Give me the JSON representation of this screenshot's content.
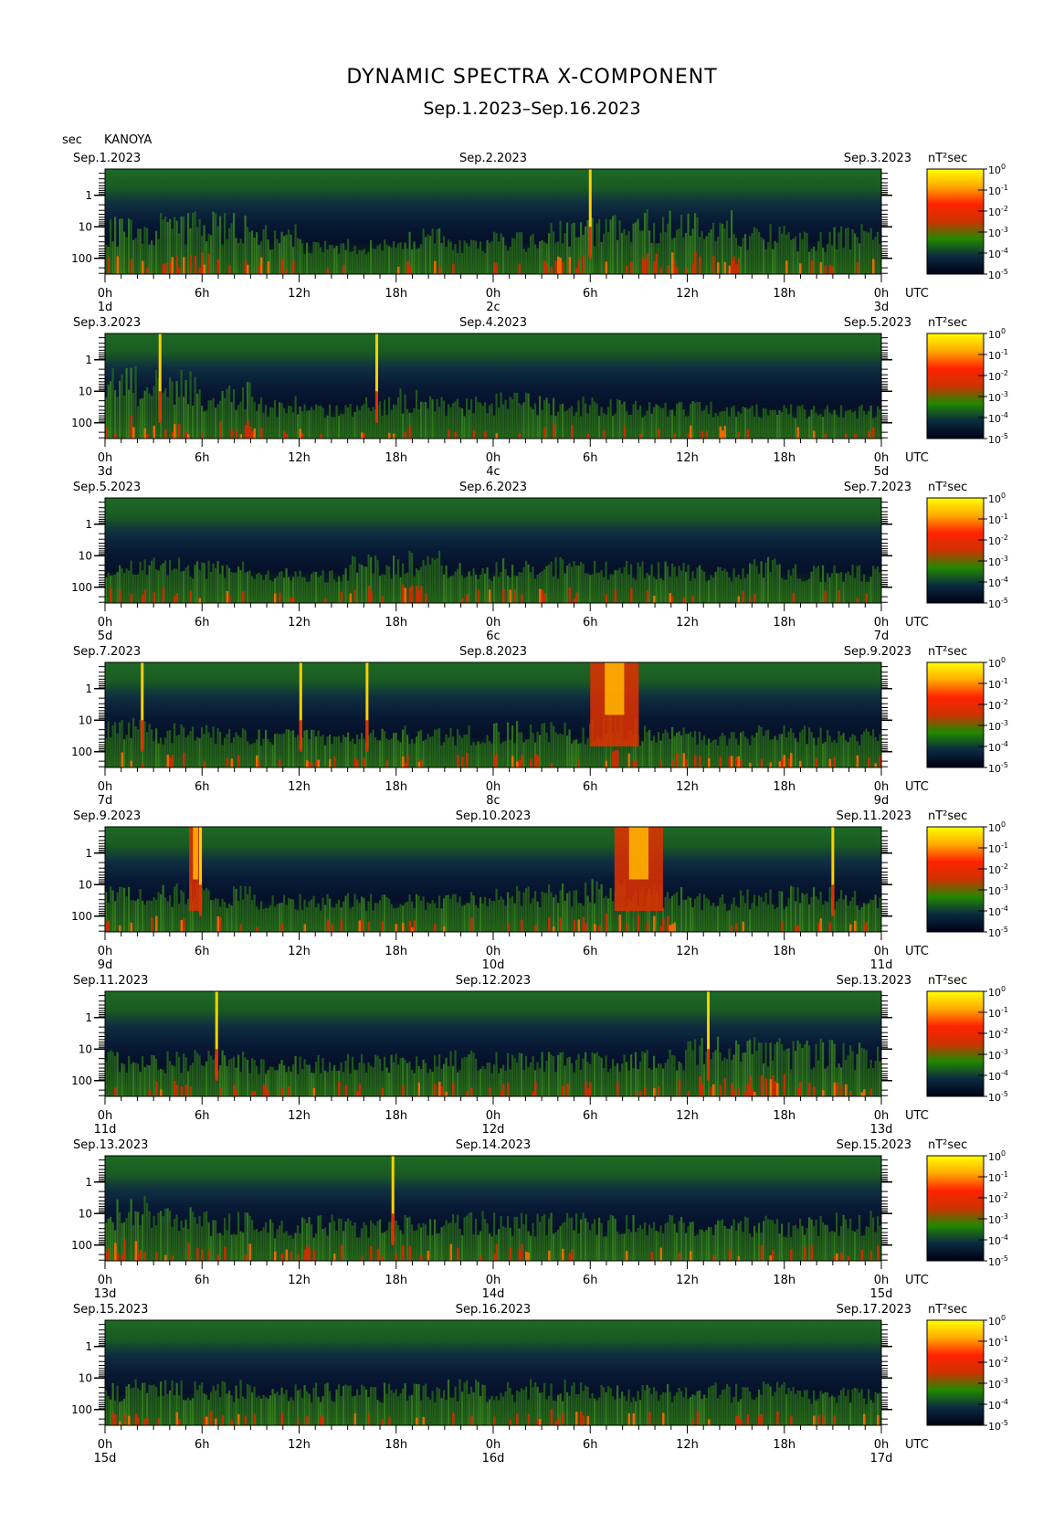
{
  "header": {
    "title": "DYNAMIC SPECTRA X-COMPONENT",
    "subtitle": "Sep.1.2023–Sep.16.2023",
    "unit_left": "sec",
    "station": "KANOYA"
  },
  "chart_data": {
    "type": "heatmap",
    "y_axis": {
      "ticks": [
        "1",
        "10",
        "100"
      ],
      "scale": "log",
      "unit": "sec"
    },
    "x_axis": {
      "hour_ticks": [
        "0h",
        "6h",
        "12h",
        "18h",
        "0h",
        "6h",
        "12h",
        "18h",
        "0h"
      ],
      "utc_label": "UTC"
    },
    "colorbar": {
      "unit_label": "nT²sec",
      "tick_exponents": [
        "0",
        "-1",
        "-2",
        "-3",
        "-4",
        "-5"
      ],
      "colors": [
        "#ffff00",
        "#ffaa00",
        "#ff2200",
        "#cc3300",
        "#228800",
        "#0a2a40",
        "#000015"
      ]
    },
    "panels": [
      {
        "date_left": "Sep.1.2023",
        "date_mid": "Sep.2.2023",
        "date_right": "Sep.3.2023",
        "day_left": "1d",
        "day_mid": "2c",
        "day_right": "3d",
        "spikes": [
          30
        ],
        "strong_events": [],
        "activity_profile": [
          0.6,
          0.7,
          0.7,
          0.5,
          0.3,
          0.3,
          0.45,
          0.3,
          0.4,
          0.6,
          0.65,
          0.7,
          0.7,
          0.5,
          0.4,
          0.5
        ]
      },
      {
        "date_left": "Sep.3.2023",
        "date_mid": "Sep.4.2023",
        "date_right": "Sep.5.2023",
        "day_left": "3d",
        "day_mid": "4c",
        "day_right": "5d",
        "spikes": [
          3.4,
          16.8
        ],
        "strong_events": [],
        "activity_profile": [
          0.8,
          0.8,
          0.6,
          0.4,
          0.3,
          0.4,
          0.5,
          0.4,
          0.45,
          0.4,
          0.4,
          0.35,
          0.35,
          0.3,
          0.3,
          0.3
        ]
      },
      {
        "date_left": "Sep.5.2023",
        "date_mid": "Sep.6.2023",
        "date_right": "Sep.7.2023",
        "day_left": "5d",
        "day_mid": "6c",
        "day_right": "7d",
        "spikes": [],
        "strong_events": [],
        "activity_profile": [
          0.45,
          0.45,
          0.4,
          0.3,
          0.3,
          0.5,
          0.55,
          0.4,
          0.45,
          0.45,
          0.4,
          0.4,
          0.35,
          0.45,
          0.35,
          0.35
        ]
      },
      {
        "date_left": "Sep.7.2023",
        "date_mid": "Sep.8.2023",
        "date_right": "Sep.9.2023",
        "day_left": "7d",
        "day_mid": "8c",
        "day_right": "9d",
        "spikes": [
          2.3,
          12.1,
          16.2
        ],
        "strong_events": [
          [
            30.0,
            33.0
          ]
        ],
        "activity_profile": [
          0.5,
          0.45,
          0.4,
          0.35,
          0.35,
          0.35,
          0.4,
          0.4,
          0.45,
          0.45,
          0.55,
          0.4,
          0.35,
          0.4,
          0.4,
          0.35
        ]
      },
      {
        "date_left": "Sep.9.2023",
        "date_mid": "Sep.10.2023",
        "date_right": "Sep.11.2023",
        "day_left": "9d",
        "day_mid": "10d",
        "day_right": "11d",
        "spikes": [
          5.9,
          45.0
        ],
        "strong_events": [
          [
            31.5,
            34.5
          ],
          [
            5.2,
            6.0
          ]
        ],
        "activity_profile": [
          0.45,
          0.5,
          0.45,
          0.35,
          0.35,
          0.35,
          0.35,
          0.4,
          0.45,
          0.5,
          0.55,
          0.45,
          0.35,
          0.4,
          0.45,
          0.4
        ]
      },
      {
        "date_left": "Sep.11.2023",
        "date_mid": "Sep.12.2023",
        "date_right": "Sep.13.2023",
        "day_left": "11d",
        "day_mid": "12d",
        "day_right": "13d",
        "spikes": [
          6.9,
          37.3
        ],
        "strong_events": [],
        "activity_profile": [
          0.45,
          0.45,
          0.45,
          0.4,
          0.4,
          0.4,
          0.4,
          0.45,
          0.45,
          0.45,
          0.45,
          0.5,
          0.65,
          0.7,
          0.6,
          0.55
        ]
      },
      {
        "date_left": "Sep.13.2023",
        "date_mid": "Sep.14.2023",
        "date_right": "Sep.15.2023",
        "day_left": "13d",
        "day_mid": "14d",
        "day_right": "15d",
        "spikes": [
          17.8
        ],
        "strong_events": [],
        "activity_profile": [
          0.7,
          0.55,
          0.5,
          0.4,
          0.45,
          0.4,
          0.45,
          0.5,
          0.5,
          0.5,
          0.45,
          0.45,
          0.4,
          0.45,
          0.45,
          0.5
        ]
      },
      {
        "date_left": "Sep.15.2023",
        "date_mid": "Sep.16.2023",
        "date_right": "Sep.17.2023",
        "day_left": "15d",
        "day_mid": "16d",
        "day_right": "17d",
        "spikes": [],
        "strong_events": [],
        "activity_profile": [
          0.45,
          0.5,
          0.45,
          0.4,
          0.4,
          0.4,
          0.4,
          0.45,
          0.45,
          0.45,
          0.4,
          0.4,
          0.4,
          0.45,
          0.35,
          0.35
        ]
      }
    ]
  }
}
